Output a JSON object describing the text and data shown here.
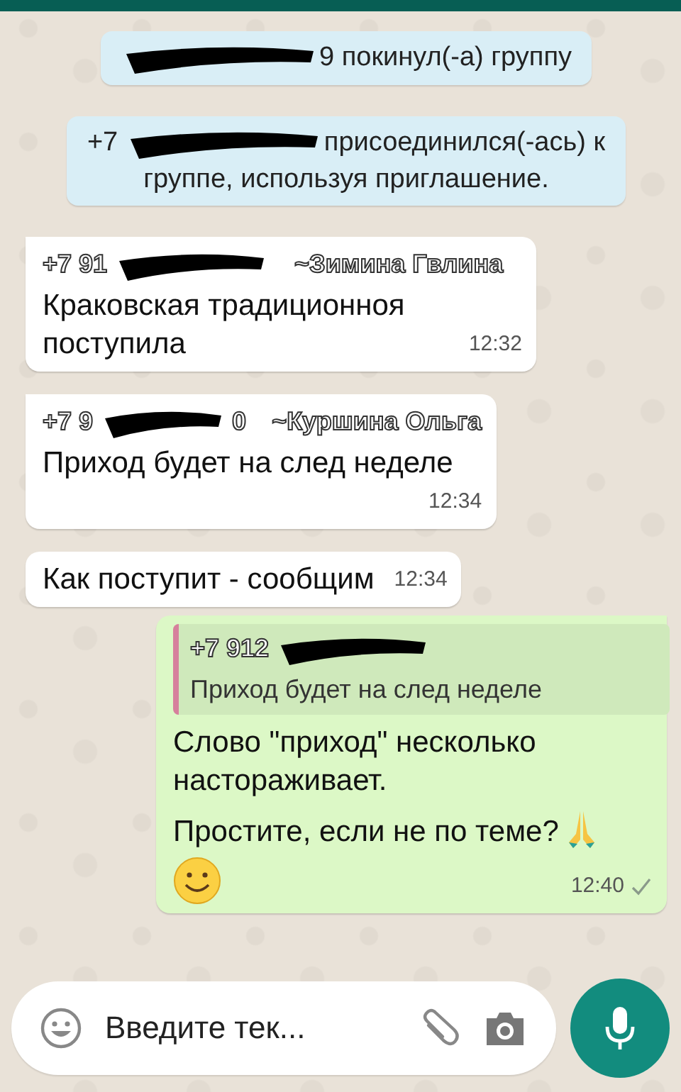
{
  "system_messages": [
    {
      "parts": [
        {
          "kind": "redacted"
        },
        {
          "kind": "text",
          "text": "9 покинул(-а) группу"
        }
      ]
    },
    {
      "parts": [
        {
          "kind": "text",
          "text": "+7"
        },
        {
          "kind": "redacted"
        },
        {
          "kind": "text",
          "text": "присоединился(-ась) к"
        },
        {
          "kind": "break"
        },
        {
          "kind": "text",
          "text": "группе, используя приглашение."
        }
      ]
    }
  ],
  "messages": [
    {
      "outgoing": false,
      "tail": true,
      "sender": {
        "phone_start": "+7 91",
        "name": "~Зимина Гвлина"
      },
      "paragraphs": [
        "Краковская традиционноя поступила"
      ],
      "time": "12:32",
      "time_below": false
    },
    {
      "outgoing": false,
      "tail": true,
      "sender": {
        "phone_start": "+7 9",
        "phone_end": "0",
        "name": "~Куршина Ольга"
      },
      "paragraphs": [
        "Приход будет на след неделе"
      ],
      "time": "12:34",
      "time_below": true
    },
    {
      "outgoing": false,
      "tail": false,
      "paragraphs": [
        "Как поступит - сообщим"
      ],
      "time": "12:34",
      "time_below": false
    },
    {
      "outgoing": true,
      "tail": true,
      "quote": {
        "phone_start": "+7 912",
        "text": "Приход будет на след неделе"
      },
      "paragraphs": [
        "Слово \"приход\" несколько настораживает.",
        "Простите, если не по теме?"
      ],
      "pray_emoji": true,
      "smiley_emoji": true,
      "time": "12:40",
      "read": false
    }
  ],
  "composer": {
    "placeholder": "Введите тек..."
  }
}
